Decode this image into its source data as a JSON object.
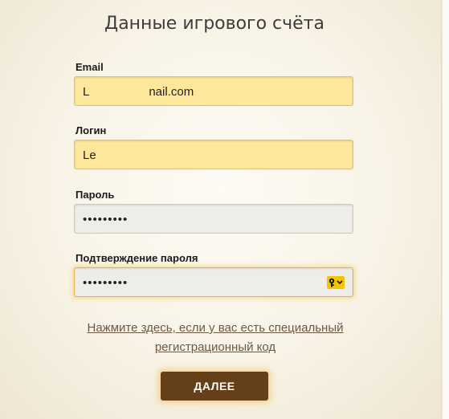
{
  "title": "Данные игрового счёта",
  "fields": {
    "email": {
      "label": "Email",
      "value_start": "L",
      "value_end": "nail.com"
    },
    "login": {
      "label": "Логин",
      "value": "Le"
    },
    "password": {
      "label": "Пароль",
      "value": "•••••••••"
    },
    "confirm": {
      "label": "Подтверждение пароля",
      "value": "•••••••••"
    }
  },
  "link": {
    "line1": "Нажмите здесь, если у вас есть специальный",
    "line2": "регистрационный код"
  },
  "next_button": "ДАЛЕЕ",
  "colors": {
    "input_yellow": "#fde79a",
    "input_gray": "#efede8",
    "button_brown": "#643f18",
    "focus_glow": "#fac850"
  },
  "icons": {
    "password_manager": "key-icon"
  }
}
